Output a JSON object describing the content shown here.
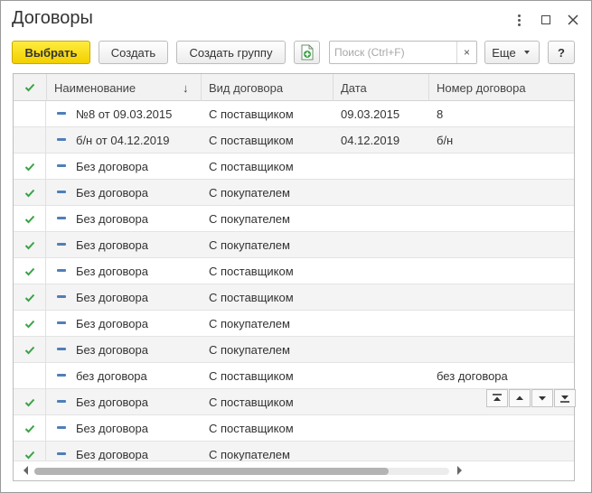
{
  "window": {
    "title": "Договоры"
  },
  "toolbar": {
    "select_label": "Выбрать",
    "create_label": "Создать",
    "create_group_label": "Создать группу",
    "search_placeholder": "Поиск (Ctrl+F)",
    "search_value": "",
    "clear_label": "×",
    "more_label": "Еще",
    "help_label": "?"
  },
  "table": {
    "columns": [
      "Наименование",
      "Вид договора",
      "Дата",
      "Номер договора"
    ],
    "sort_indicator": "↓",
    "rows": [
      {
        "checked": false,
        "name": "№8 от 09.03.2015",
        "type": "С поставщиком",
        "date": "09.03.2015",
        "number": "8"
      },
      {
        "checked": false,
        "name": "б/н от 04.12.2019",
        "type": "С поставщиком",
        "date": "04.12.2019",
        "number": "б/н"
      },
      {
        "checked": true,
        "name": "Без договора",
        "type": "С поставщиком",
        "date": "",
        "number": ""
      },
      {
        "checked": true,
        "name": "Без договора",
        "type": "С покупателем",
        "date": "",
        "number": ""
      },
      {
        "checked": true,
        "name": "Без договора",
        "type": "С покупателем",
        "date": "",
        "number": ""
      },
      {
        "checked": true,
        "name": "Без договора",
        "type": "С покупателем",
        "date": "",
        "number": ""
      },
      {
        "checked": true,
        "name": "Без договора",
        "type": "С поставщиком",
        "date": "",
        "number": ""
      },
      {
        "checked": true,
        "name": "Без договора",
        "type": "С поставщиком",
        "date": "",
        "number": ""
      },
      {
        "checked": true,
        "name": "Без договора",
        "type": "С покупателем",
        "date": "",
        "number": ""
      },
      {
        "checked": true,
        "name": "Без договора",
        "type": "С покупателем",
        "date": "",
        "number": ""
      },
      {
        "checked": false,
        "name": "без договора",
        "type": "С поставщиком",
        "date": "",
        "number": "без договора"
      },
      {
        "checked": true,
        "name": "Без договора",
        "type": "С поставщиком",
        "date": "",
        "number": ""
      },
      {
        "checked": true,
        "name": "Без договора",
        "type": "С поставщиком",
        "date": "",
        "number": ""
      },
      {
        "checked": true,
        "name": "Без договора",
        "type": "С покупателем",
        "date": "",
        "number": ""
      }
    ]
  },
  "colors": {
    "primary_button": "#f7dc14",
    "check_green": "#3aa346",
    "item_icon_blue": "#4f7fb8"
  }
}
